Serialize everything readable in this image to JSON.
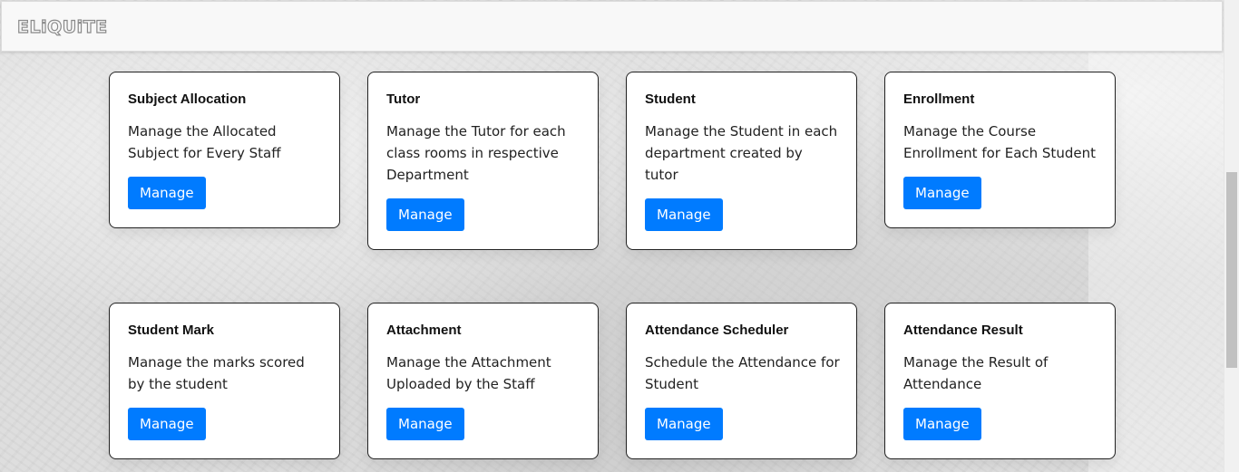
{
  "navbar": {
    "brand": "ELiQUiTE"
  },
  "cards": [
    {
      "title": "Subject Allocation",
      "text": "Manage the Allocated Subject for Every Staff",
      "button": "Manage"
    },
    {
      "title": "Tutor",
      "text": "Manage the Tutor for each class rooms in respective Department",
      "button": "Manage"
    },
    {
      "title": "Student",
      "text": "Manage the Student in each department created by tutor",
      "button": "Manage"
    },
    {
      "title": "Enrollment",
      "text": "Manage the Course Enrollment for Each Student",
      "button": "Manage"
    },
    {
      "title": "Student Mark",
      "text": "Manage the marks scored by the student",
      "button": "Manage"
    },
    {
      "title": "Attachment",
      "text": "Manage the Attachment Uploaded by the Staff",
      "button": "Manage"
    },
    {
      "title": "Attendance Scheduler",
      "text": "Schedule the Attendance for Student",
      "button": "Manage"
    },
    {
      "title": "Attendance Result",
      "text": "Manage the Result of Attendance",
      "button": "Manage"
    }
  ],
  "colors": {
    "primary": "#007bff",
    "navbar_bg": "#f8f8f8",
    "card_border": "#222222"
  }
}
